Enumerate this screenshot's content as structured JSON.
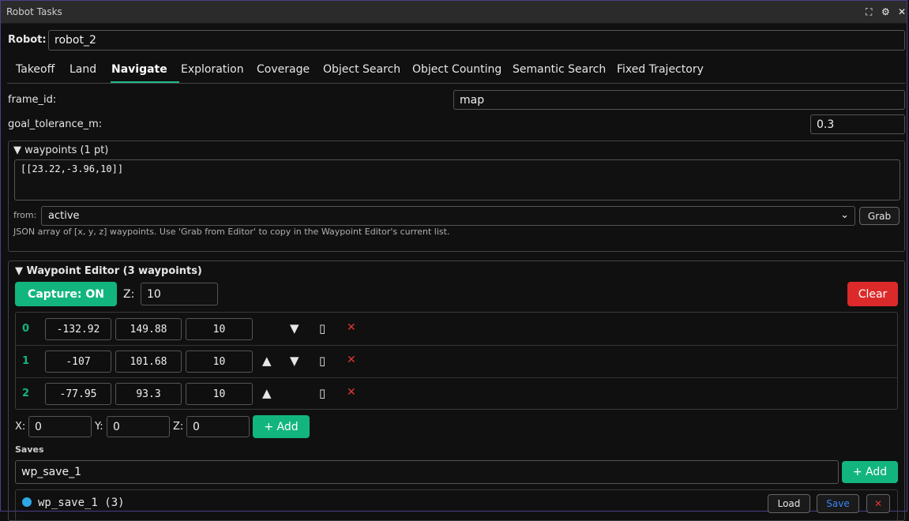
{
  "window": {
    "title": "Robot Tasks",
    "icons": [
      "fullscreen-icon",
      "gear-icon",
      "close-icon"
    ]
  },
  "robot": {
    "label": "Robot:",
    "value": "robot_2"
  },
  "tabs": [
    {
      "label": "Takeoff"
    },
    {
      "label": "Land"
    },
    {
      "label": "Navigate"
    },
    {
      "label": "Exploration"
    },
    {
      "label": "Coverage"
    },
    {
      "label": "Object Search"
    },
    {
      "label": "Object Counting"
    },
    {
      "label": "Semantic Search"
    },
    {
      "label": "Fixed Trajectory"
    }
  ],
  "active_tab": "Navigate",
  "frame_id": {
    "label": "frame_id:",
    "value": "map"
  },
  "goal_tolerance": {
    "label": "goal_tolerance_m:",
    "value": "0.3"
  },
  "waypoints_section": {
    "title": "▼ waypoints (1 pt)",
    "json_value": "[[23.22,-3.96,10]]",
    "from_label": "from:",
    "from_value": "active",
    "grab_label": "Grab",
    "help_text": "JSON array of [x, y, z] waypoints. Use 'Grab from Editor' to copy in the Waypoint Editor's current list."
  },
  "editor": {
    "title": "▼ Waypoint Editor (3 waypoints)",
    "capture_label": "Capture: ON",
    "z_label": "Z:",
    "z_value": "10",
    "clear_label": "Clear",
    "rows": [
      {
        "index": "0",
        "x": "-132.92",
        "y": "149.88",
        "z": "10",
        "up": "",
        "down": "▼",
        "copy": "▯",
        "del": "✕"
      },
      {
        "index": "1",
        "x": "-107",
        "y": "101.68",
        "z": "10",
        "up": "▲",
        "down": "▼",
        "copy": "▯",
        "del": "✕"
      },
      {
        "index": "2",
        "x": "-77.95",
        "y": "93.3",
        "z": "10",
        "up": "▲",
        "down": "",
        "copy": "▯",
        "del": "✕"
      }
    ],
    "new_point": {
      "x_label": "X:",
      "x_value": "0",
      "y_label": "Y:",
      "y_value": "0",
      "z_label": "Z:",
      "z_value": "0",
      "add_label": "+ Add"
    },
    "saves": {
      "header": "Saves",
      "name_value": "wp_save_1",
      "add_label": "+ Add",
      "items": [
        {
          "name": "wp_save_1 (3)",
          "load": "Load",
          "save": "Save",
          "del": "✕"
        }
      ]
    }
  },
  "colors": {
    "accent": "#13b57f",
    "danger": "#dc2a2a",
    "save_link": "#3b82f6",
    "dot": "#2ea8e6"
  }
}
